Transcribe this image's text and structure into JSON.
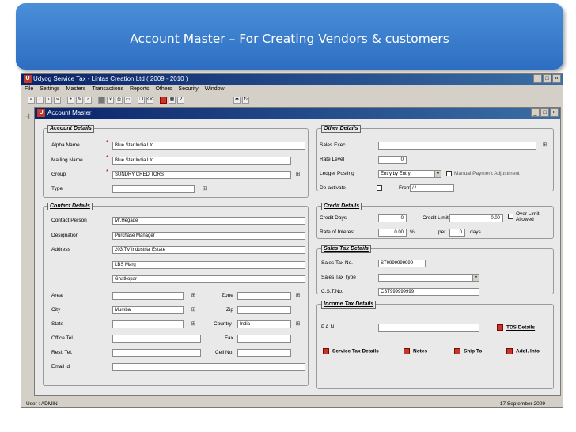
{
  "slide": {
    "title": "Account Master – For Creating Vendors & customers"
  },
  "app": {
    "title": "Udyog Service Tax - Lintas Creation Ltd ( 2009 - 2010 )",
    "menu": [
      "File",
      "Settings",
      "Masters",
      "Transactions",
      "Reports",
      "Others",
      "Security",
      "Window"
    ],
    "status_user": "User : ADMIN",
    "status_date": "17 September 2009"
  },
  "window": {
    "title": "Account Master"
  },
  "account_details": {
    "section": "Account Details",
    "alpha_name_label": "Alpha Name",
    "alpha_name_value": "Blue Star India Ltd",
    "mailing_name_label": "Mailing Name",
    "mailing_name_value": "Blue Star India Ltd",
    "group_label": "Group",
    "group_value": "SUNDRY CREDITORS",
    "type_label": "Type",
    "type_value": "",
    "required_mark": "*"
  },
  "contact_details": {
    "section": "Contact Details",
    "contact_person_label": "Contact Person",
    "contact_person_value": "Mr.Hegade",
    "designation_label": "Designation",
    "designation_value": "Purchase Manager",
    "address_label": "Address",
    "address_lines": [
      "203,TV Industrial Estate",
      "LBS Marg",
      "Ghatkopar"
    ],
    "area_label": "Area",
    "area_value": "",
    "zone_label": "Zone",
    "zone_value": "",
    "city_label": "City",
    "city_value": "Mumbai",
    "zip_label": "Zip",
    "zip_value": "",
    "state_label": "State",
    "state_value": "",
    "country_label": "Country",
    "country_value": "India",
    "office_tel_label": "Office Tel.",
    "office_tel_value": "",
    "fax_label": "Fax",
    "fax_value": "",
    "resi_tel_label": "Resi. Tel.",
    "resi_tel_value": "",
    "cell_label": "Cell No.",
    "cell_value": "",
    "email_label": "Email id",
    "email_value": ""
  },
  "other_details": {
    "section": "Other Details",
    "sales_exec_label": "Sales Exec.",
    "sales_exec_value": "",
    "rate_level_label": "Rate Level",
    "rate_level_value": "0",
    "ledger_posting_label": "Ledger Posting",
    "ledger_posting_value": "Entry by Entry",
    "manual_label": "Manual Payment Adjustment",
    "deactivate_label": "De-activate",
    "from_label": "From",
    "from_value": "/ /"
  },
  "credit_details": {
    "section": "Credit Details",
    "credit_days_label": "Credit Days",
    "credit_days_value": "0",
    "credit_limit_label": "Credit Limit",
    "credit_limit_value": "0.00",
    "over_limit_label": "Over Limit Allowed",
    "rate_interest_label": "Rate of Interest",
    "rate_interest_value": "0.00",
    "percent_label": "%",
    "per_label": "per",
    "per_value": "0",
    "days_label": "days"
  },
  "sales_tax_details": {
    "section": "Sales Tax Details",
    "sales_tax_no_label": "Sales Tax No.",
    "sales_tax_no_value": "ST9999999999",
    "sales_tax_type_label": "Sales Tax Type",
    "sales_tax_type_value": "",
    "cst_label": "C.S.T.No.",
    "cst_value": "CST999999999"
  },
  "income_tax_details": {
    "section": "Income Tax Details",
    "pan_label": "P.A.N.",
    "pan_value": "",
    "tds_label": "TDS Details"
  },
  "buttons": {
    "service_tax": "Service Tax Details",
    "notes": "Notes",
    "ship_to": "Ship To",
    "addl_info": "Addl. Info"
  }
}
